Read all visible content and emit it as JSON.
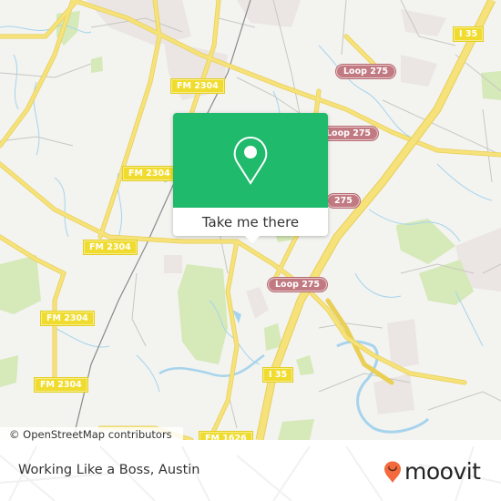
{
  "map": {
    "attribution": "© OpenStreetMap contributors",
    "road_labels": [
      {
        "id": "fm2304-top",
        "text": "FM 2304",
        "type": "fm"
      },
      {
        "id": "fm2304-mid",
        "text": "FM 2304",
        "type": "fm"
      },
      {
        "id": "fm2304-left",
        "text": "FM 2304",
        "type": "fm"
      },
      {
        "id": "fm2304-lower",
        "text": "FM 2304",
        "type": "fm"
      },
      {
        "id": "fm2304-bottom",
        "text": "FM 2304",
        "type": "fm"
      },
      {
        "id": "loop275-a",
        "text": "Loop 275",
        "type": "loop"
      },
      {
        "id": "loop275-b",
        "text": "Loop 275",
        "type": "loop"
      },
      {
        "id": "loop275-c",
        "text": "275",
        "type": "loop"
      },
      {
        "id": "loop275-d",
        "text": "Loop 275",
        "type": "loop"
      },
      {
        "id": "i35-top",
        "text": "I 35",
        "type": "interstate"
      },
      {
        "id": "i35-mid",
        "text": "I 35",
        "type": "interstate"
      },
      {
        "id": "fm1626",
        "text": "FM 1626",
        "type": "fm"
      }
    ],
    "colors": {
      "background": "#f3f3f0",
      "road": "#f6e27a",
      "water": "#a6d4ec",
      "park": "#d6e9b8",
      "minor_road": "#bdbdbd"
    }
  },
  "popup": {
    "icon": "location-pin-icon",
    "button_label": "Take me there",
    "accent_color": "#1fba6b"
  },
  "footer": {
    "place_name": "Working Like a Boss, Austin",
    "brand": {
      "name": "moovit",
      "logo_icon": "moovit-pin-smile-icon",
      "logo_color": "#f26a3d"
    }
  }
}
